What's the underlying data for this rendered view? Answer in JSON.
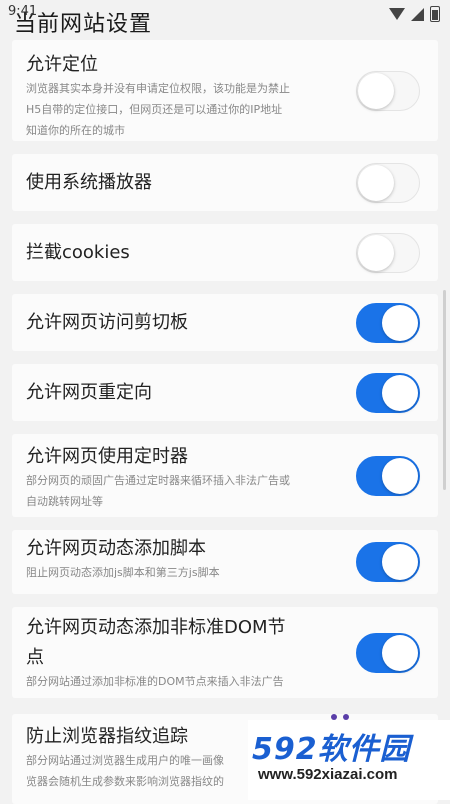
{
  "status": {
    "time": "9:41"
  },
  "page": {
    "title": "当前网站设置"
  },
  "settings": [
    {
      "title": "允许定位",
      "desc_lines": [
        "浏览器其实本身并没有申请定位权限，该功能是为禁止",
        "H5自带的定位接口，但网页还是可以通过你的IP地址",
        "知道你的所在的城市"
      ],
      "enabled": false
    },
    {
      "title": "使用系统播放器",
      "desc_lines": [],
      "enabled": false
    },
    {
      "title": "拦截cookies",
      "desc_lines": [],
      "enabled": false
    },
    {
      "title": "允许网页访问剪切板",
      "desc_lines": [],
      "enabled": true
    },
    {
      "title": "允许网页重定向",
      "desc_lines": [],
      "enabled": true
    },
    {
      "title": "允许网页使用定时器",
      "desc_lines": [
        "部分网页的顽固广告通过定时器来循环插入非法广告或",
        "自动跳转网址等"
      ],
      "enabled": true
    },
    {
      "title": "允许网页动态添加脚本",
      "desc_lines": [
        "阻止网页动态添加js脚本和第三方js脚本"
      ],
      "enabled": true
    },
    {
      "title_lines": [
        "允许网页动态添加非标准DOM节",
        "点"
      ],
      "desc_lines": [
        "部分网站通过添加非标准的DOM节点来插入非法广告"
      ],
      "enabled": true
    },
    {
      "title": "防止浏览器指纹追踪",
      "desc_lines": [
        "部分网站通过浏览器生成用户的唯一画像",
        "览器会随机生成参数来影响浏览器指纹的"
      ],
      "enabled": null
    }
  ],
  "watermark": {
    "logo": "592软件园",
    "url": "www.592xiazai.com"
  },
  "colors": {
    "accent": "#1a73e8",
    "card": "#fbfbfb",
    "background": "#f2f2f2"
  }
}
